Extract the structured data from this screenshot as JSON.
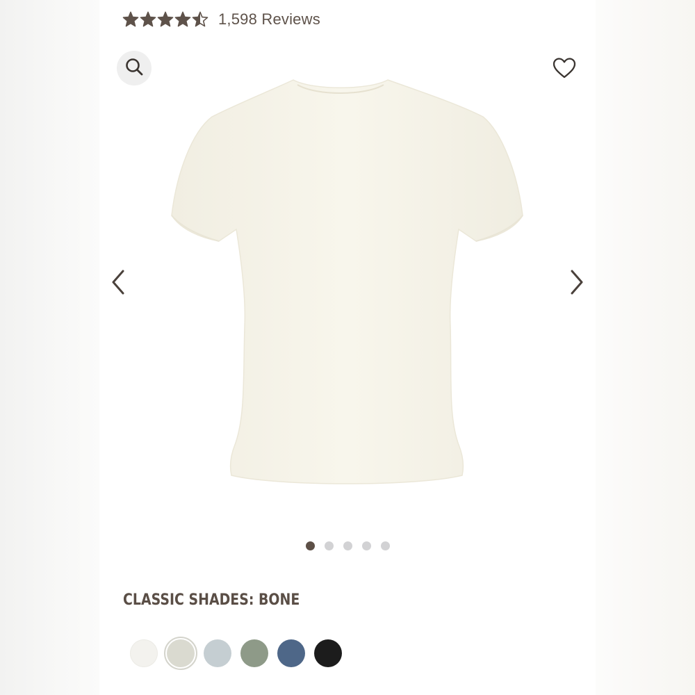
{
  "rating": {
    "stars_value": 4.5,
    "stars_max": 5,
    "review_count_text": "1,598 Reviews",
    "star_color": "#5e524a"
  },
  "icons": {
    "search": "search-icon",
    "wishlist": "heart-icon",
    "previous": "chevron-left-icon",
    "next": "chevron-right-icon"
  },
  "gallery": {
    "image_count": 5,
    "active_index": 0,
    "product_color": "#f6f3e8"
  },
  "shades": {
    "label": "CLASSIC SHADES: BONE",
    "selected_index": 1,
    "options": [
      {
        "color": "#f3f2ee"
      },
      {
        "color": "#dadad0"
      },
      {
        "color": "#c5ced2"
      },
      {
        "color": "#8e9a88"
      },
      {
        "color": "#4e6788"
      },
      {
        "color": "#1c1c1c"
      }
    ]
  }
}
